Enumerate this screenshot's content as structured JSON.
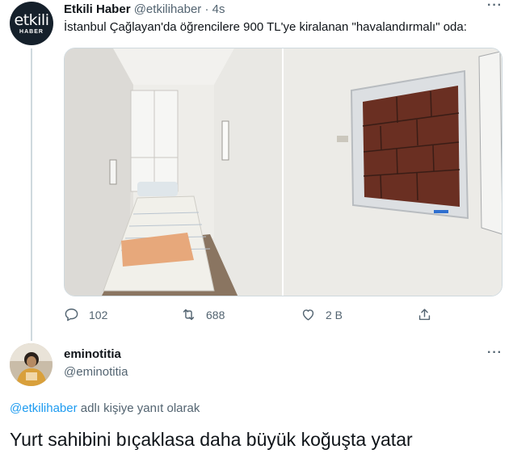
{
  "tweet": {
    "avatar_text": "etkili",
    "avatar_subtext": "HABER",
    "display_name": "Etkili Haber",
    "handle_time": "@etkilihaber · 4s",
    "text": "İstanbul Çağlayan'da öğrencilere 900 TL'ye kiralanan \"havalandırmalı\" oda:",
    "media": [
      {
        "icon": "room-photo"
      },
      {
        "icon": "window-photo"
      }
    ],
    "actions": {
      "reply_count": "102",
      "retweet_count": "688",
      "like_count": "2 B"
    },
    "more": "···"
  },
  "reply": {
    "display_name": "eminotitia",
    "handle": "@eminotitia",
    "reply_to_mention": "@etkilihaber",
    "reply_to_suffix": " adlı kişiye yanıt olarak",
    "text": "Yurt sahibini bıçaklasa daha büyük koğuşta yatar",
    "more": "···"
  },
  "colors": {
    "link": "#1d9bf0",
    "secondary_text": "#536471",
    "primary_text": "#0f1419"
  }
}
